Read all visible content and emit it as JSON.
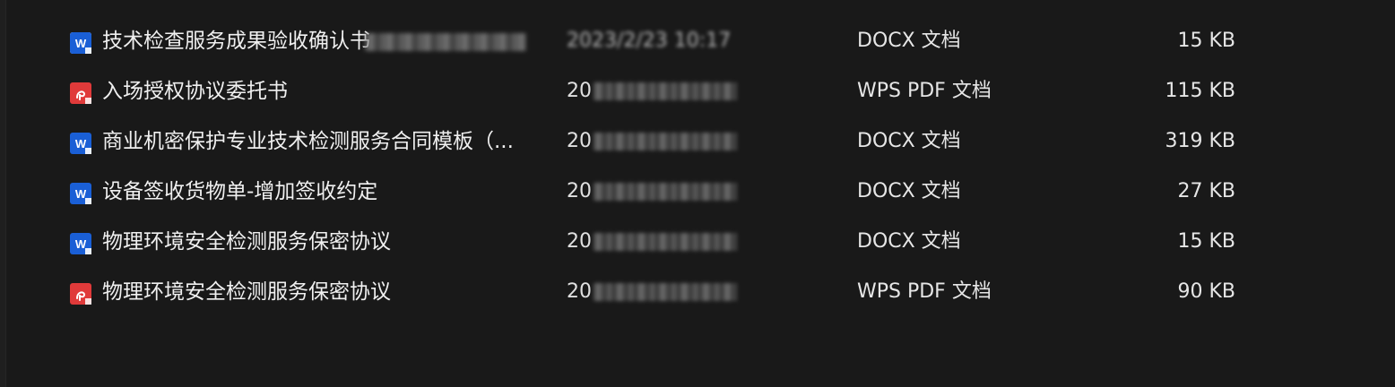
{
  "rows": [
    {
      "name": "技术检查服务成果验收确认书",
      "name_blurred_suffix": true,
      "date": "2023/2/23 10:17",
      "type": "DOCX 文档",
      "size": "15 KB",
      "icon": "word-doc-icon"
    },
    {
      "name": "入场授权协议委托书",
      "date": "20",
      "type": "WPS PDF 文档",
      "size": "115 KB",
      "icon": "wps-pdf-icon"
    },
    {
      "name": "商业机密保护专业技术检测服务合同模板（...",
      "date": "20",
      "type": "DOCX 文档",
      "size": "319 KB",
      "icon": "word-doc-icon"
    },
    {
      "name": "设备签收货物单-增加签收约定",
      "date": "20",
      "type": "DOCX 文档",
      "size": "27 KB",
      "icon": "word-doc-icon"
    },
    {
      "name": "物理环境安全检测服务保密协议",
      "date": "20",
      "type": "DOCX 文档",
      "size": "15 KB",
      "icon": "word-doc-icon"
    },
    {
      "name": "物理环境安全检测服务保密协议",
      "date": "20",
      "type": "WPS PDF 文档",
      "size": "90 KB",
      "icon": "wps-pdf-icon"
    }
  ],
  "colors": {
    "background": "#191919",
    "word_blue": "#1a5fd6",
    "pdf_red": "#e03a3a"
  }
}
